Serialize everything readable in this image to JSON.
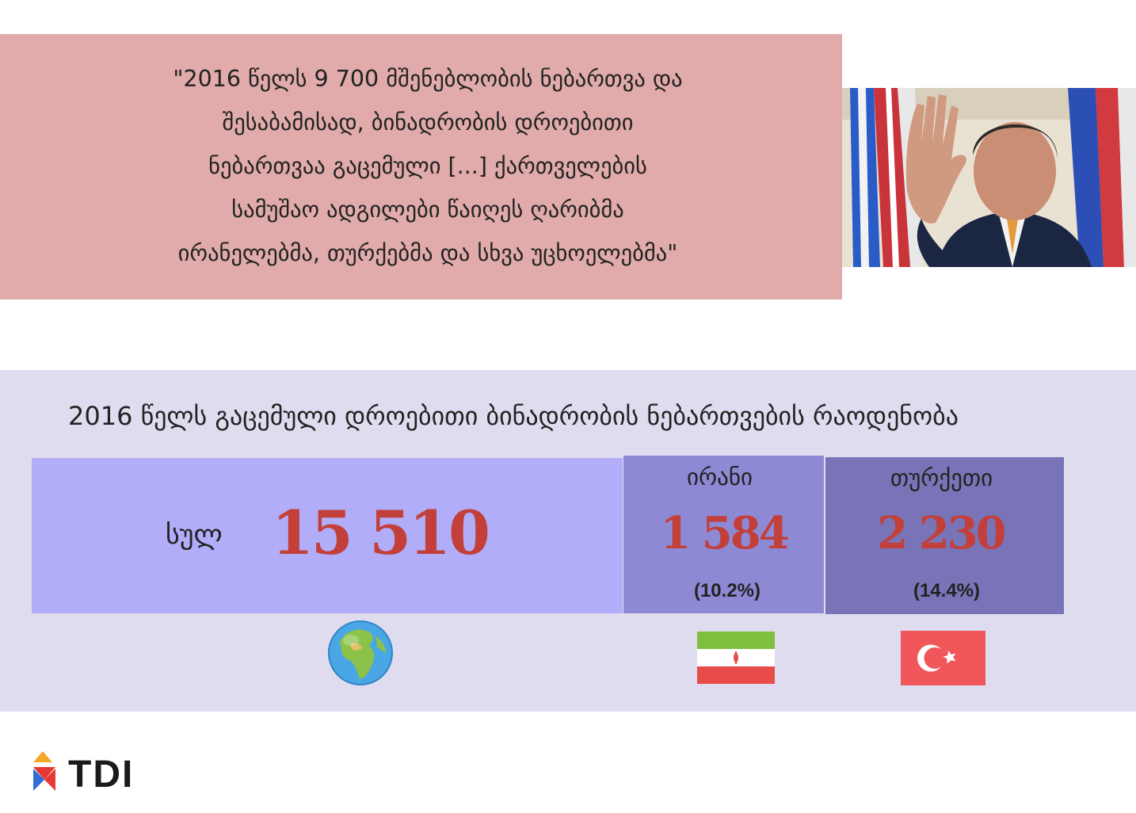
{
  "quote": {
    "lines": [
      "\"2016 წელს 9 700 მშენებლობის ნებართვა და",
      "შესაბამისად, ბინადრობის დროებითი",
      "ნებართვაა გაცემული [...] ქართველების",
      "სამუშაო ადგილები წაიღეს ღარიბმა",
      "ირანელებმა, თურქებმა და სხვა უცხოელებმა\""
    ],
    "box_color": "#e0abaa"
  },
  "stats": {
    "title": "2016 წელს გაცემული დროებითი ბინადრობის ნებართვების რაოდენობა",
    "world": {
      "label": "სულ",
      "value": "15 510",
      "icon": "globe-icon",
      "color": "#b1adf9"
    },
    "iran": {
      "label": "ირანი",
      "value": "1 584",
      "percent": "(10.2%)",
      "icon": "iran-flag-icon",
      "color": "#8e89d5"
    },
    "turkey": {
      "label": "თურქეთი",
      "value": "2 230",
      "percent": "(14.4%)",
      "icon": "turkey-flag-icon",
      "color": "#7874b7"
    },
    "number_color": "#c3403a"
  },
  "logo": {
    "text": "TDI"
  }
}
